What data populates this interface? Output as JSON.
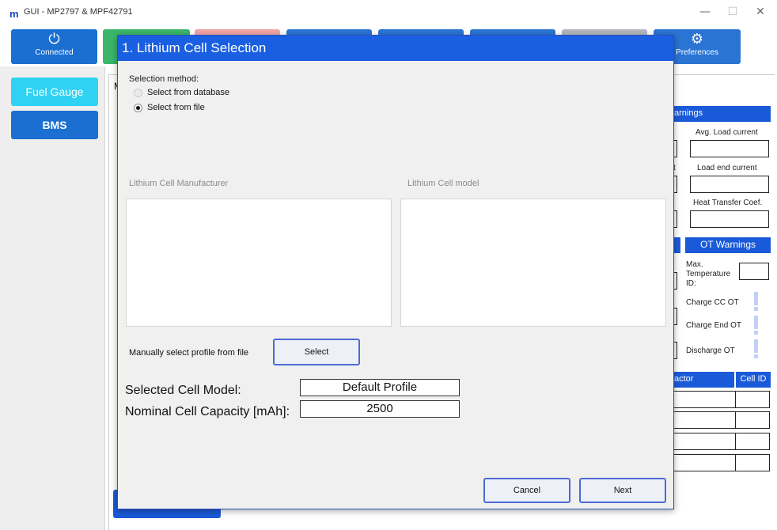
{
  "window": {
    "logo": "m",
    "title": "GUI - MP2797 & MPF42791",
    "minimize": "—",
    "maximize": "☐",
    "close": "✕"
  },
  "toolbar": {
    "connected_icon": "⏻",
    "connected_label": "Connected",
    "preferences_icon": "⚙",
    "preferences_label": "Preferences"
  },
  "sidebar": {
    "items": [
      {
        "label": "Fuel Gauge"
      },
      {
        "label": "BMS"
      }
    ]
  },
  "background": {
    "peek_letter": "M",
    "warnings_header": "arnings",
    "avg_load_current": "Avg. Load current",
    "load_end_current": "Load end current",
    "load_end_prefix": "t",
    "heat_transfer": "Heat Transfer Coef.",
    "ot_warnings": "OT Warnings",
    "max_temp_id": "Max. Temperature ID:",
    "charge_cc_ot": "Charge CC OT",
    "charge_end_ot": "Charge End OT",
    "discharge_ot": "Discharge OT",
    "factor_header": "actor",
    "cell_id_header": "Cell ID"
  },
  "dialog": {
    "title": "1. Lithium Cell Selection",
    "selection_method_label": "Selection method:",
    "option_database": "Select from database",
    "option_file": "Select from file",
    "selected_option": "file",
    "manufacturer_label": "Lithium Cell Manufacturer",
    "model_label": "Lithium Cell model",
    "manual_label": "Manually select profile from file",
    "select_button": "Select",
    "selected_cell_model_label": "Selected Cell Model:",
    "selected_cell_model_value": "Default Profile",
    "nominal_capacity_label": "Nominal Cell Capacity [mAh]:",
    "nominal_capacity_value": "2500",
    "cancel_button": "Cancel",
    "next_button": "Next"
  },
  "colors": {
    "dialog_header": "#1a5fe2",
    "connected_button": "#1a6fd1",
    "fuel_gauge_button": "#2fd2f2",
    "button_border": "#4b6bd3"
  }
}
